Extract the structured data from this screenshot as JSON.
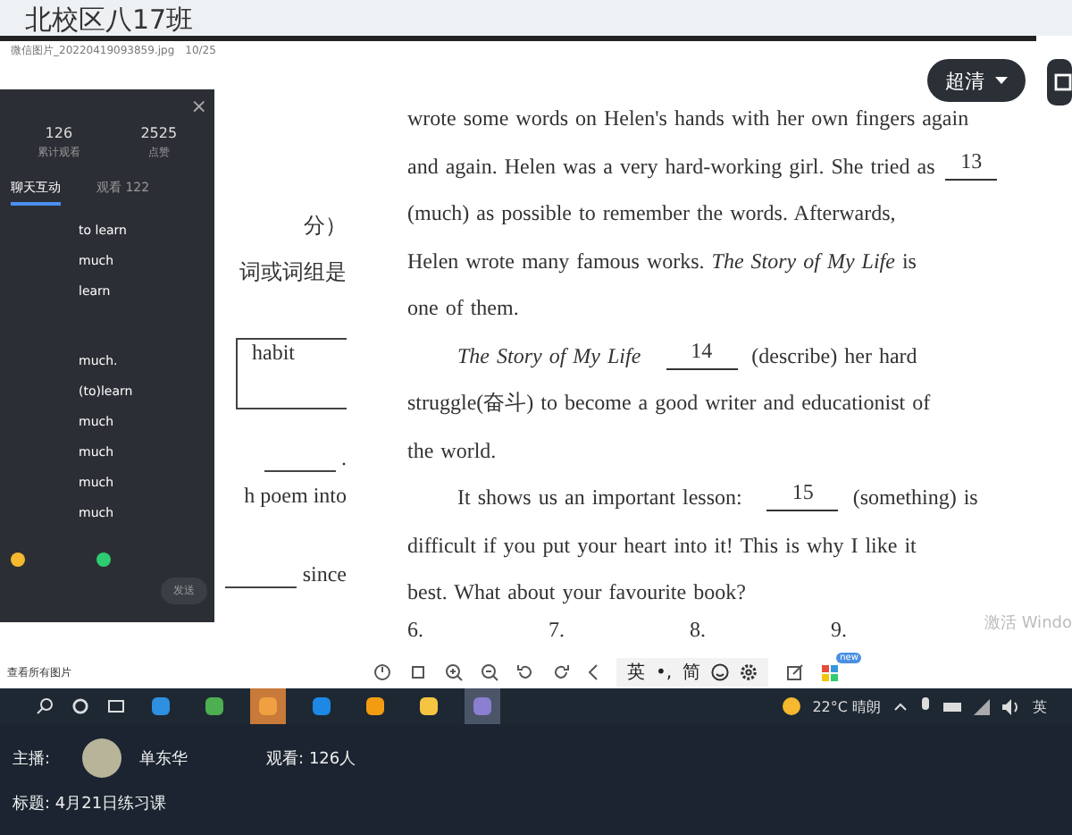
{
  "room_title": "北校区八17班",
  "viewer": {
    "file_name": "微信图片_20220419093859.jpg",
    "page": "10/25",
    "quality_button": "超清",
    "view_all": "查看所有图片",
    "activation": "激活 Windo"
  },
  "document": {
    "left_fragments": [
      {
        "kind": "text",
        "text": "分）"
      },
      {
        "kind": "text",
        "text": "词或词组是"
      },
      {
        "kind": "box",
        "text": "habit"
      },
      {
        "kind": "line",
        "text": "."
      },
      {
        "kind": "text",
        "text": "h poem into"
      },
      {
        "kind": "line",
        "text": "since"
      }
    ],
    "lines": [
      {
        "indent": false,
        "parts": [
          {
            "kind": "text",
            "text": "wrote some words on Helen's hands with her own fingers again"
          }
        ]
      },
      {
        "indent": false,
        "parts": [
          {
            "kind": "text",
            "text": "and again. Helen was a very hard-working girl. She tried as"
          },
          {
            "kind": "blank",
            "text": "13"
          }
        ]
      },
      {
        "indent": false,
        "parts": [
          {
            "kind": "text",
            "text": "(much) as possible to remember the words. Afterwards,"
          }
        ]
      },
      {
        "indent": false,
        "parts": [
          {
            "kind": "text",
            "text": "Helen wrote many famous works. *The Story of My Life* is"
          }
        ]
      },
      {
        "indent": false,
        "parts": [
          {
            "kind": "text",
            "text": "one of them."
          }
        ]
      },
      {
        "indent": true,
        "parts": [
          {
            "kind": "text",
            "text": "*The Story of My Life*"
          },
          {
            "kind": "blank",
            "text": "14"
          },
          {
            "kind": "text",
            "text": "(describe) her hard"
          }
        ]
      },
      {
        "indent": false,
        "parts": [
          {
            "kind": "text",
            "text": "struggle(奋斗) to become a good writer and educationist of"
          }
        ]
      },
      {
        "indent": false,
        "parts": [
          {
            "kind": "text",
            "text": "the world."
          }
        ]
      },
      {
        "indent": true,
        "parts": [
          {
            "kind": "text",
            "text": "It shows us an important lesson:"
          },
          {
            "kind": "blank",
            "text": "15"
          },
          {
            "kind": "text",
            "text": "(something) is"
          }
        ]
      },
      {
        "indent": false,
        "parts": [
          {
            "kind": "text",
            "text": "difficult if you put your heart into it! This is why I like it"
          }
        ]
      },
      {
        "indent": false,
        "parts": [
          {
            "kind": "text",
            "text": "best. What about your favourite book?"
          }
        ]
      }
    ],
    "numbers": [
      "6.",
      "7.",
      "8.",
      "9."
    ]
  },
  "chat_panel": {
    "close": "×",
    "stats": [
      {
        "value": "126",
        "label": "累计观看"
      },
      {
        "value": "2525",
        "label": "点赞"
      }
    ],
    "tabs": [
      {
        "label": "聊天互动",
        "selected": true
      },
      {
        "label": "观看 122",
        "selected": false
      }
    ],
    "messages": [
      "to learn",
      "much",
      "learn",
      "much.",
      "(to)learn",
      "much",
      "much",
      "much",
      "much"
    ],
    "send_button": "发送"
  },
  "toolbar": {
    "ime": [
      "英",
      "•,",
      "简"
    ],
    "badge": "new"
  },
  "taskbar": {
    "weather": "22°C 晴朗",
    "ime": "英"
  },
  "stream_info": {
    "host_label": "主播:",
    "host_name": "单东华",
    "viewers": "观看: 126人",
    "title": "标题: 4月21日练习课"
  }
}
